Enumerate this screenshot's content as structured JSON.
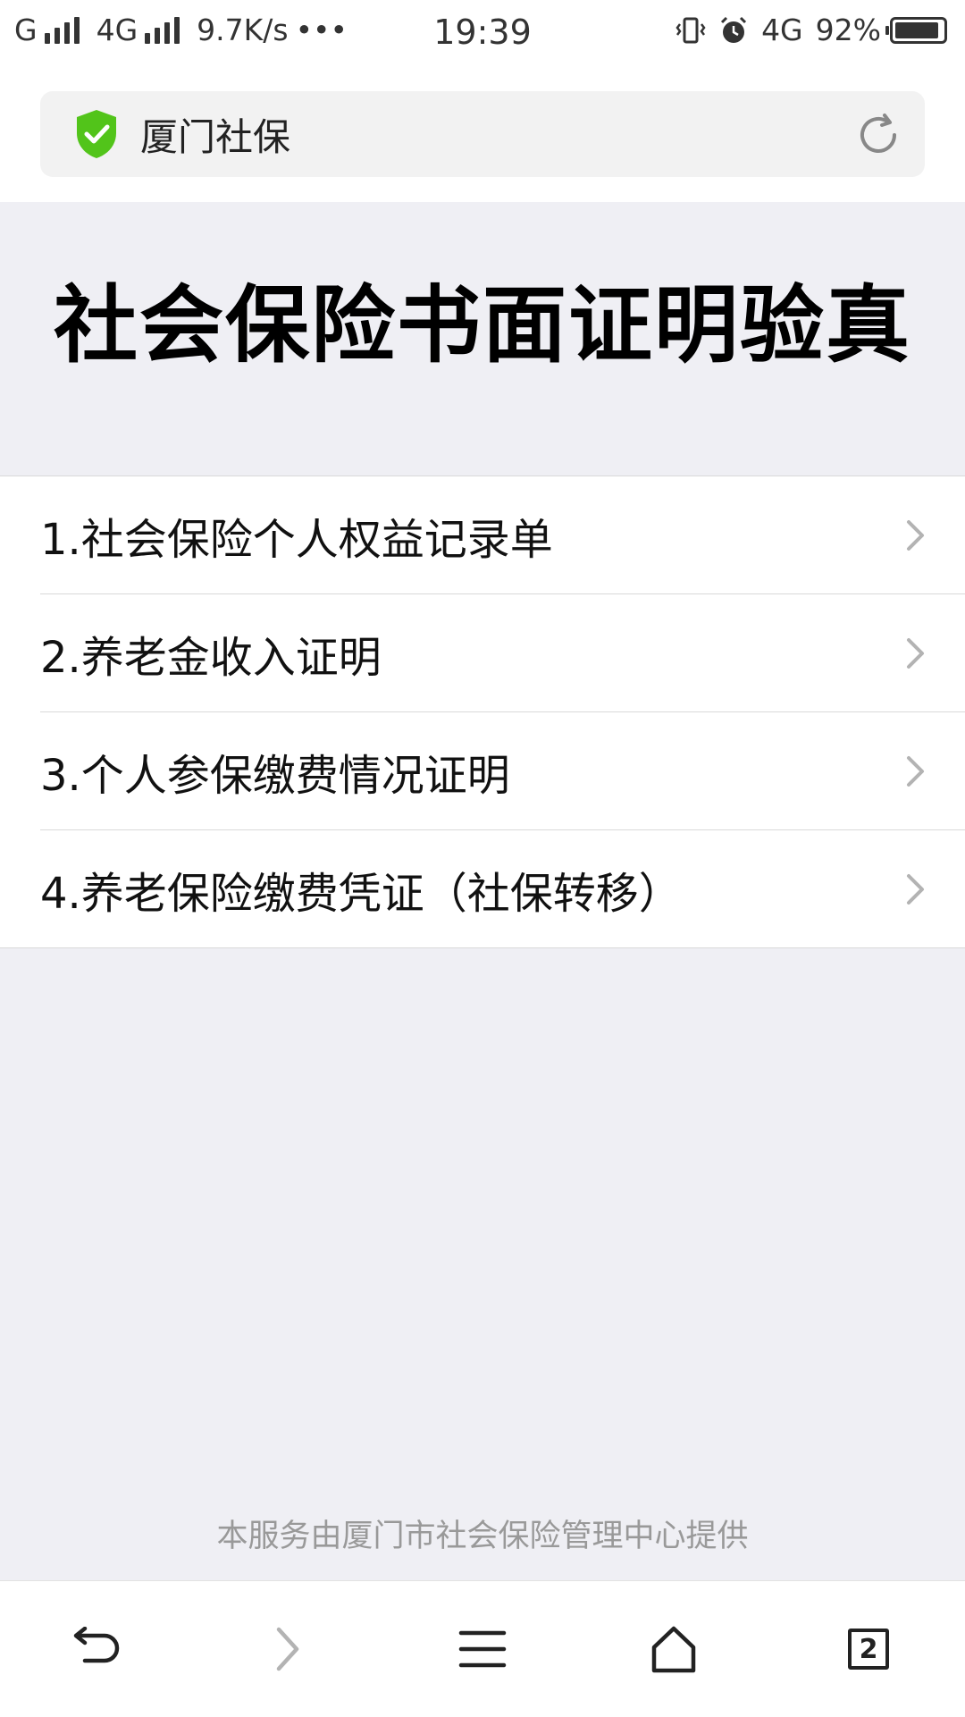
{
  "status_bar": {
    "carrier_1": "G",
    "carrier_2": "4G",
    "speed": "9.7K/s",
    "more": "•••",
    "time": "19:39",
    "network_right": "4G",
    "battery_percent": "92%",
    "battery_level": 0.92
  },
  "address_bar": {
    "site_name": "厦门社保",
    "secure_color": "#52c41a"
  },
  "header": {
    "title": "社会保险书面证明验真"
  },
  "menu": {
    "items": [
      {
        "label": "1.社会保险个人权益记录单"
      },
      {
        "label": "2.养老金收入证明"
      },
      {
        "label": "3.个人参保缴费情况证明"
      },
      {
        "label": "4.养老保险缴费凭证（社保转移）"
      }
    ]
  },
  "footer": {
    "text": "本服务由厦门市社会保险管理中心提供"
  },
  "bottom_nav": {
    "tab_count": "2"
  }
}
